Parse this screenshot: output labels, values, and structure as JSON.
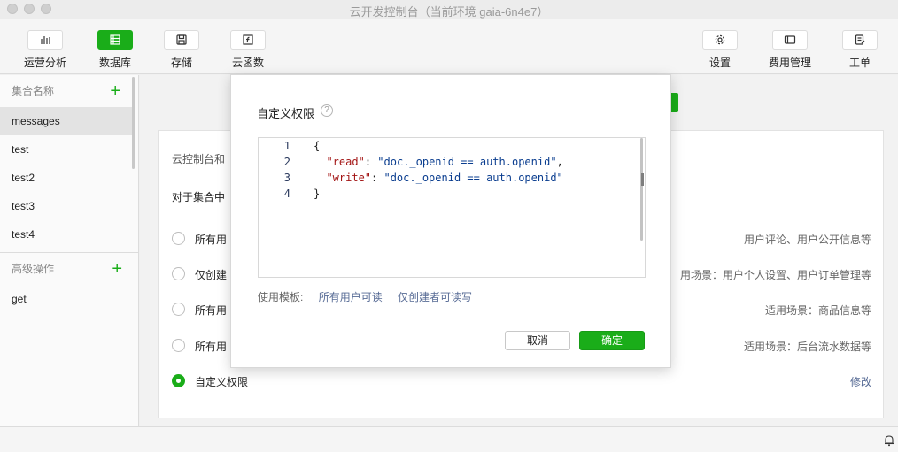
{
  "window": {
    "title": "云开发控制台（当前环境 gaia-6n4e7）"
  },
  "toolbar": {
    "left": [
      {
        "label": "运营分析",
        "icon": "bar-chart-icon"
      },
      {
        "label": "数据库",
        "icon": "database-icon",
        "active": true
      },
      {
        "label": "存储",
        "icon": "storage-icon"
      },
      {
        "label": "云函数",
        "icon": "function-icon"
      }
    ],
    "right": [
      {
        "label": "设置",
        "icon": "gear-icon"
      },
      {
        "label": "费用管理",
        "icon": "billing-icon"
      },
      {
        "label": "工单",
        "icon": "ticket-icon"
      }
    ]
  },
  "sidebar": {
    "collections_header": "集合名称",
    "collections": [
      "messages",
      "test",
      "test2",
      "test3",
      "test4"
    ],
    "advanced_header": "高级操作",
    "advanced_items": [
      "get"
    ]
  },
  "main": {
    "desc_partial": "云控制台和",
    "hint_partial": "对于集合中",
    "options": [
      {
        "label": "所有用",
        "scene": "用户评论、用户公开信息等"
      },
      {
        "label": "仅创建",
        "scene": "用场景：用户个人设置、用户订单管理等"
      },
      {
        "label": "所有用",
        "scene": "适用场景：商品信息等"
      },
      {
        "label": "所有用",
        "scene": "适用场景：后台流水数据等"
      },
      {
        "label": "自定义权限",
        "link": "修改",
        "checked": true
      }
    ]
  },
  "modal": {
    "title": "自定义权限",
    "help": "?",
    "code": {
      "line_numbers": [
        "1",
        "2",
        "3",
        "4"
      ],
      "open": "{",
      "close": "}",
      "read_key": "\"read\"",
      "read_val": "\"doc._openid == auth.openid\"",
      "write_key": "\"write\"",
      "write_val": "\"doc._openid == auth.openid\""
    },
    "template_label": "使用模板:",
    "templates": [
      "所有用户可读",
      "仅创建者可读写"
    ],
    "cancel_label": "取消",
    "ok_label": "确定"
  },
  "colors": {
    "accent": "#1aad19",
    "link": "#576b95"
  }
}
